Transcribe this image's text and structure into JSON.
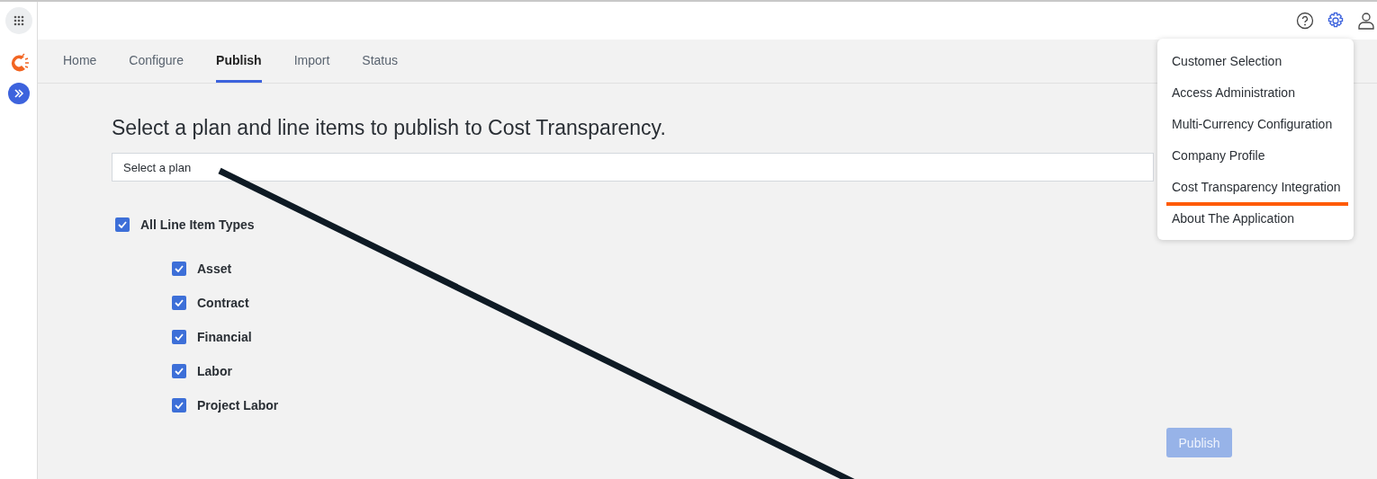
{
  "tabs": [
    {
      "label": "Home",
      "selected": false
    },
    {
      "label": "Configure",
      "selected": false
    },
    {
      "label": "Publish",
      "selected": true
    },
    {
      "label": "Import",
      "selected": false
    },
    {
      "label": "Status",
      "selected": false
    }
  ],
  "heading": "Select a plan and line items to publish to Cost Transparency.",
  "plan_select": {
    "placeholder": "Select a plan"
  },
  "all_types": {
    "label": "All Line Item Types",
    "checked": true
  },
  "line_item_types": [
    {
      "label": "Asset",
      "checked": true
    },
    {
      "label": "Contract",
      "checked": true
    },
    {
      "label": "Financial",
      "checked": true
    },
    {
      "label": "Labor",
      "checked": true
    },
    {
      "label": "Project Labor",
      "checked": true
    }
  ],
  "publish_button": {
    "label": "Publish",
    "disabled": true
  },
  "settings_menu": {
    "items": [
      {
        "label": "Customer Selection",
        "highlighted": false
      },
      {
        "label": "Access Administration",
        "highlighted": false
      },
      {
        "label": "Multi-Currency Configuration",
        "highlighted": false
      },
      {
        "label": "Company Profile",
        "highlighted": false
      },
      {
        "label": "Cost Transparency Integration",
        "highlighted": true
      },
      {
        "label": "About The Application",
        "highlighted": false
      }
    ]
  }
}
